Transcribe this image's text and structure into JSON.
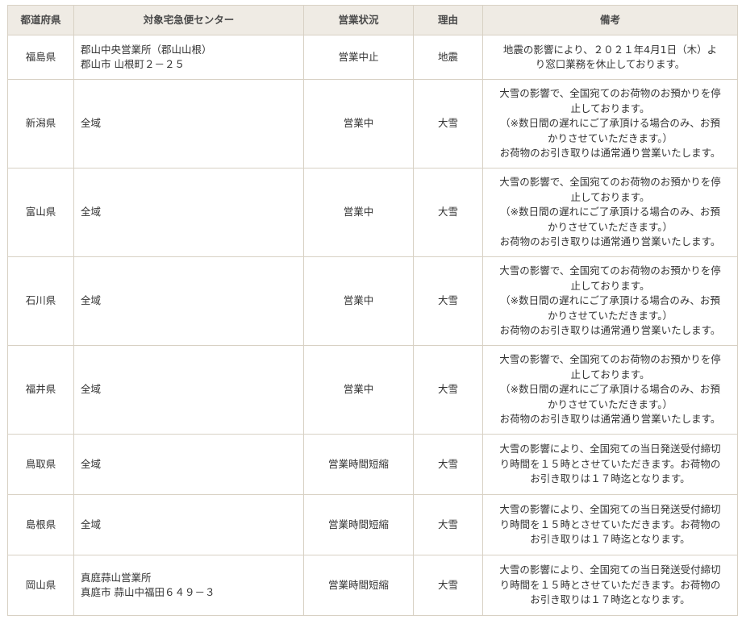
{
  "table": {
    "headers": {
      "prefecture": "都道府県",
      "center": "対象宅急便センター",
      "status": "営業状況",
      "reason": "理由",
      "note": "備考"
    },
    "rows": [
      {
        "prefecture": "福島県",
        "center_lines": [
          "郡山中央営業所（郡山山根）",
          "郡山市 山根町２－２５"
        ],
        "status": "営業中止",
        "reason": "地震",
        "note_lines": [
          "地震の影響により、２０２１年4月1日（木）よ",
          "り窓口業務を休止しております。"
        ]
      },
      {
        "prefecture": "新潟県",
        "center_lines": [
          "全域"
        ],
        "status": "営業中",
        "reason": "大雪",
        "note_lines": [
          "大雪の影響で、全国宛てのお荷物のお預かりを停",
          "止しております。",
          "（※数日間の遅れにご了承頂ける場合のみ、お預",
          "かりさせていただきます。）",
          "お荷物のお引き取りは通常通り営業いたします。"
        ]
      },
      {
        "prefecture": "富山県",
        "center_lines": [
          "全域"
        ],
        "status": "営業中",
        "reason": "大雪",
        "note_lines": [
          "大雪の影響で、全国宛てのお荷物のお預かりを停",
          "止しております。",
          "（※数日間の遅れにご了承頂ける場合のみ、お預",
          "かりさせていただきます。）",
          "お荷物のお引き取りは通常通り営業いたします。"
        ]
      },
      {
        "prefecture": "石川県",
        "center_lines": [
          "全域"
        ],
        "status": "営業中",
        "reason": "大雪",
        "note_lines": [
          "大雪の影響で、全国宛てのお荷物のお預かりを停",
          "止しております。",
          "（※数日間の遅れにご了承頂ける場合のみ、お預",
          "かりさせていただきます。）",
          "お荷物のお引き取りは通常通り営業いたします。"
        ]
      },
      {
        "prefecture": "福井県",
        "center_lines": [
          "全域"
        ],
        "status": "営業中",
        "reason": "大雪",
        "note_lines": [
          "大雪の影響で、全国宛てのお荷物のお預かりを停",
          "止しております。",
          "（※数日間の遅れにご了承頂ける場合のみ、お預",
          "かりさせていただきます。）",
          "お荷物のお引き取りは通常通り営業いたします。"
        ]
      },
      {
        "prefecture": "鳥取県",
        "center_lines": [
          "全域"
        ],
        "status": "営業時間短縮",
        "reason": "大雪",
        "note_lines": [
          "大雪の影響により、全国宛ての当日発送受付締切",
          "り時間を１５時とさせていただきます。お荷物の",
          "お引き取りは１７時迄となります。"
        ]
      },
      {
        "prefecture": "島根県",
        "center_lines": [
          "全域"
        ],
        "status": "営業時間短縮",
        "reason": "大雪",
        "note_lines": [
          "大雪の影響により、全国宛ての当日発送受付締切",
          "り時間を１５時とさせていただきます。お荷物の",
          "お引き取りは１７時迄となります。"
        ]
      },
      {
        "prefecture": "岡山県",
        "center_lines": [
          "真庭蒜山営業所",
          "真庭市 蒜山中福田６４９－３"
        ],
        "status": "営業時間短縮",
        "reason": "大雪",
        "note_lines": [
          "大雪の影響により、全国宛ての当日発送受付締切",
          "り時間を１５時とさせていただきます。お荷物の",
          "お引き取りは１７時迄となります。"
        ]
      }
    ]
  }
}
